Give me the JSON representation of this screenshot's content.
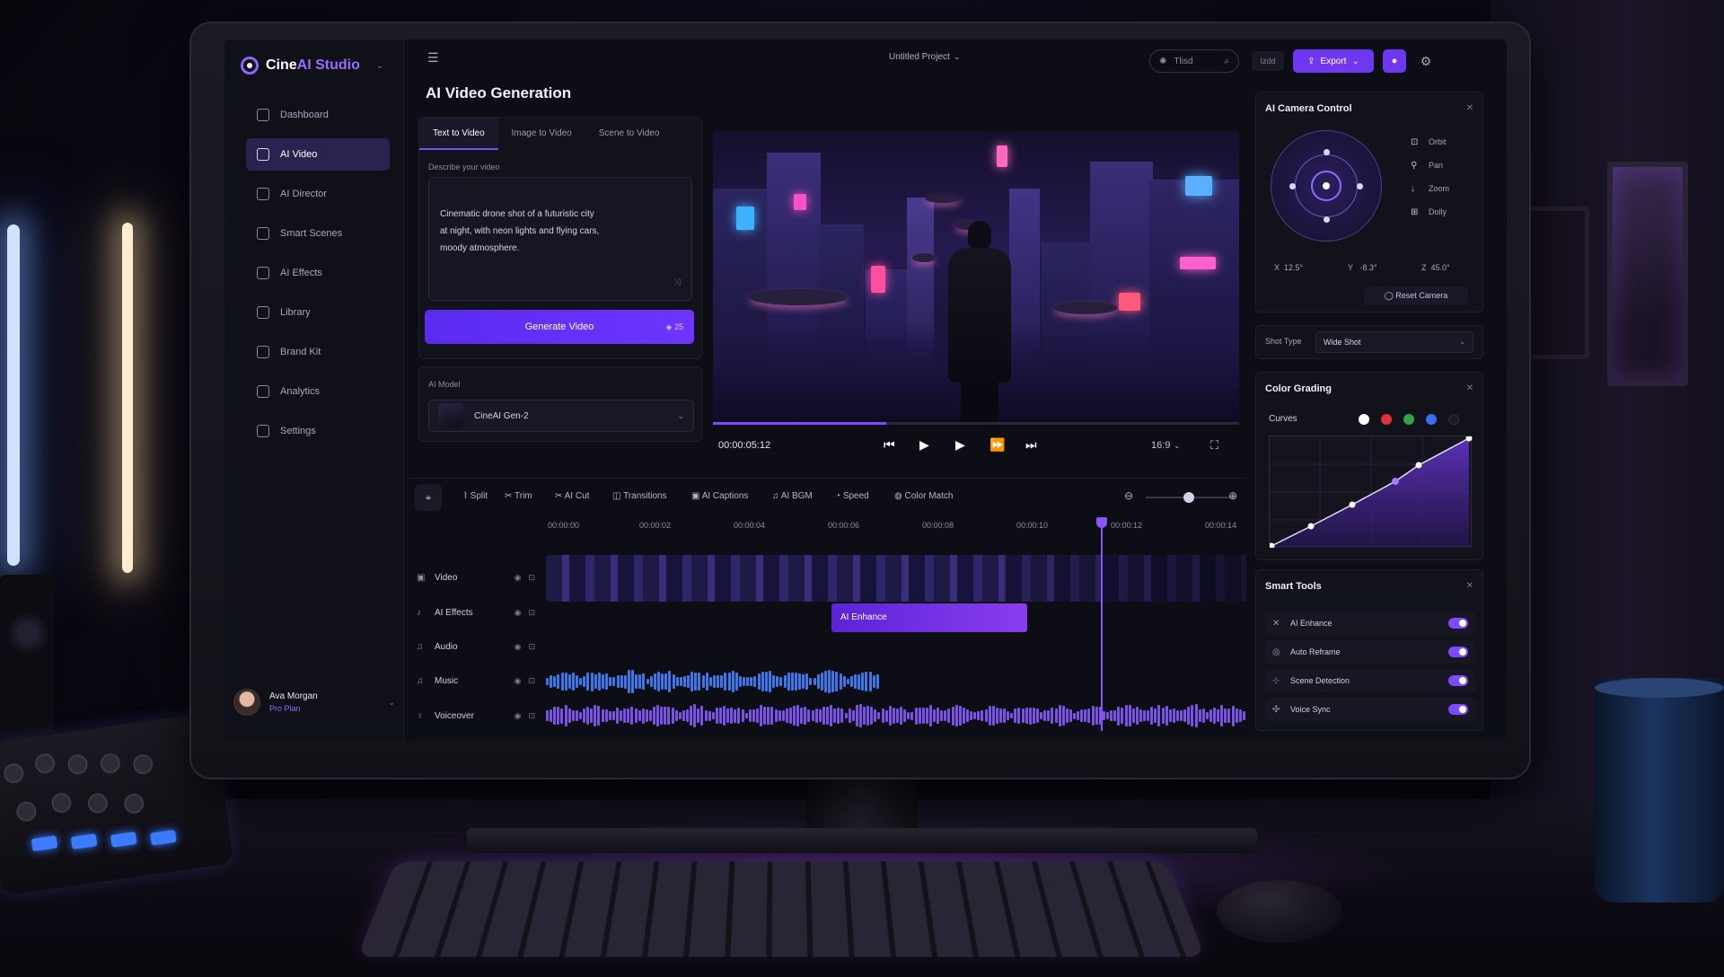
{
  "app": {
    "brand_prefix": "Cine",
    "brand_suffix": "AI Studio",
    "project_name": "Untitled Project"
  },
  "sidebar": {
    "items": [
      {
        "label": "Dashboard",
        "icon": "home-icon"
      },
      {
        "label": "AI Video",
        "icon": "video-icon"
      },
      {
        "label": "AI Director",
        "icon": "director-icon"
      },
      {
        "label": "Smart Scenes",
        "icon": "scenes-icon"
      },
      {
        "label": "AI Effects",
        "icon": "effects-icon"
      },
      {
        "label": "Library",
        "icon": "library-icon"
      },
      {
        "label": "Brand Kit",
        "icon": "brand-icon"
      },
      {
        "label": "Analytics",
        "icon": "analytics-icon"
      },
      {
        "label": "Settings",
        "icon": "gear-icon"
      }
    ],
    "active_index": 1,
    "user": {
      "name": "Ava Morgan",
      "plan": "Pro Plan"
    }
  },
  "topbar": {
    "search_text": "Tlisd",
    "small_pill": "Izdd",
    "export_label": "Export"
  },
  "generation": {
    "title": "AI Video Generation",
    "tabs": [
      "Text to Video",
      "Image to Video",
      "Scene to Video"
    ],
    "active_tab": 0,
    "prompt_label": "Describe your video",
    "prompt_text": "Cinematic drone shot of a futuristic city\nat night, with neon lights and flying cars,\nmoody atmosphere.",
    "generate_label": "Generate Video",
    "credits": "25",
    "model_label": "AI Model",
    "model_value": "CineAI Gen-2"
  },
  "player": {
    "timecode": "00:00:05:12",
    "aspect": "16:9",
    "progress": 0.33
  },
  "toolbar": {
    "tools": [
      "Split",
      "Trim",
      "AI Cut",
      "Transitions",
      "AI Captions",
      "AI BGM",
      "Speed",
      "Color Match"
    ]
  },
  "timeline": {
    "ticks": [
      "00:00:00",
      "00:00:02",
      "00:00:04",
      "00:00:06",
      "00:00:08",
      "00:00:10",
      "00:00:12",
      "00:00:14"
    ],
    "tracks": [
      "Video",
      "AI Effects",
      "Audio",
      "Music",
      "Voiceover"
    ],
    "enhance_clip": "AI Enhance"
  },
  "camera": {
    "title": "AI Camera Control",
    "modes": [
      "Orbit",
      "Pan",
      "Zoom",
      "Dolly"
    ],
    "x_label": "X",
    "x_value": "12.5°",
    "y_label": "Y",
    "y_value": "-8.3°",
    "z_label": "Z",
    "z_value": "45.0°",
    "reset_label": "Reset Camera"
  },
  "shot": {
    "label": "Shot Type",
    "value": "Wide Shot"
  },
  "color": {
    "title": "Color Grading",
    "curves_label": "Curves",
    "swatches": [
      "#ffffff",
      "#e0303a",
      "#2fa64a",
      "#3a6df0",
      "#1b1a26"
    ]
  },
  "smart_tools": {
    "title": "Smart Tools",
    "items": [
      {
        "label": "AI Enhance",
        "on": true
      },
      {
        "label": "Auto Reframe",
        "on": true
      },
      {
        "label": "Scene Detection",
        "on": true
      },
      {
        "label": "Voice Sync",
        "on": true
      }
    ]
  }
}
